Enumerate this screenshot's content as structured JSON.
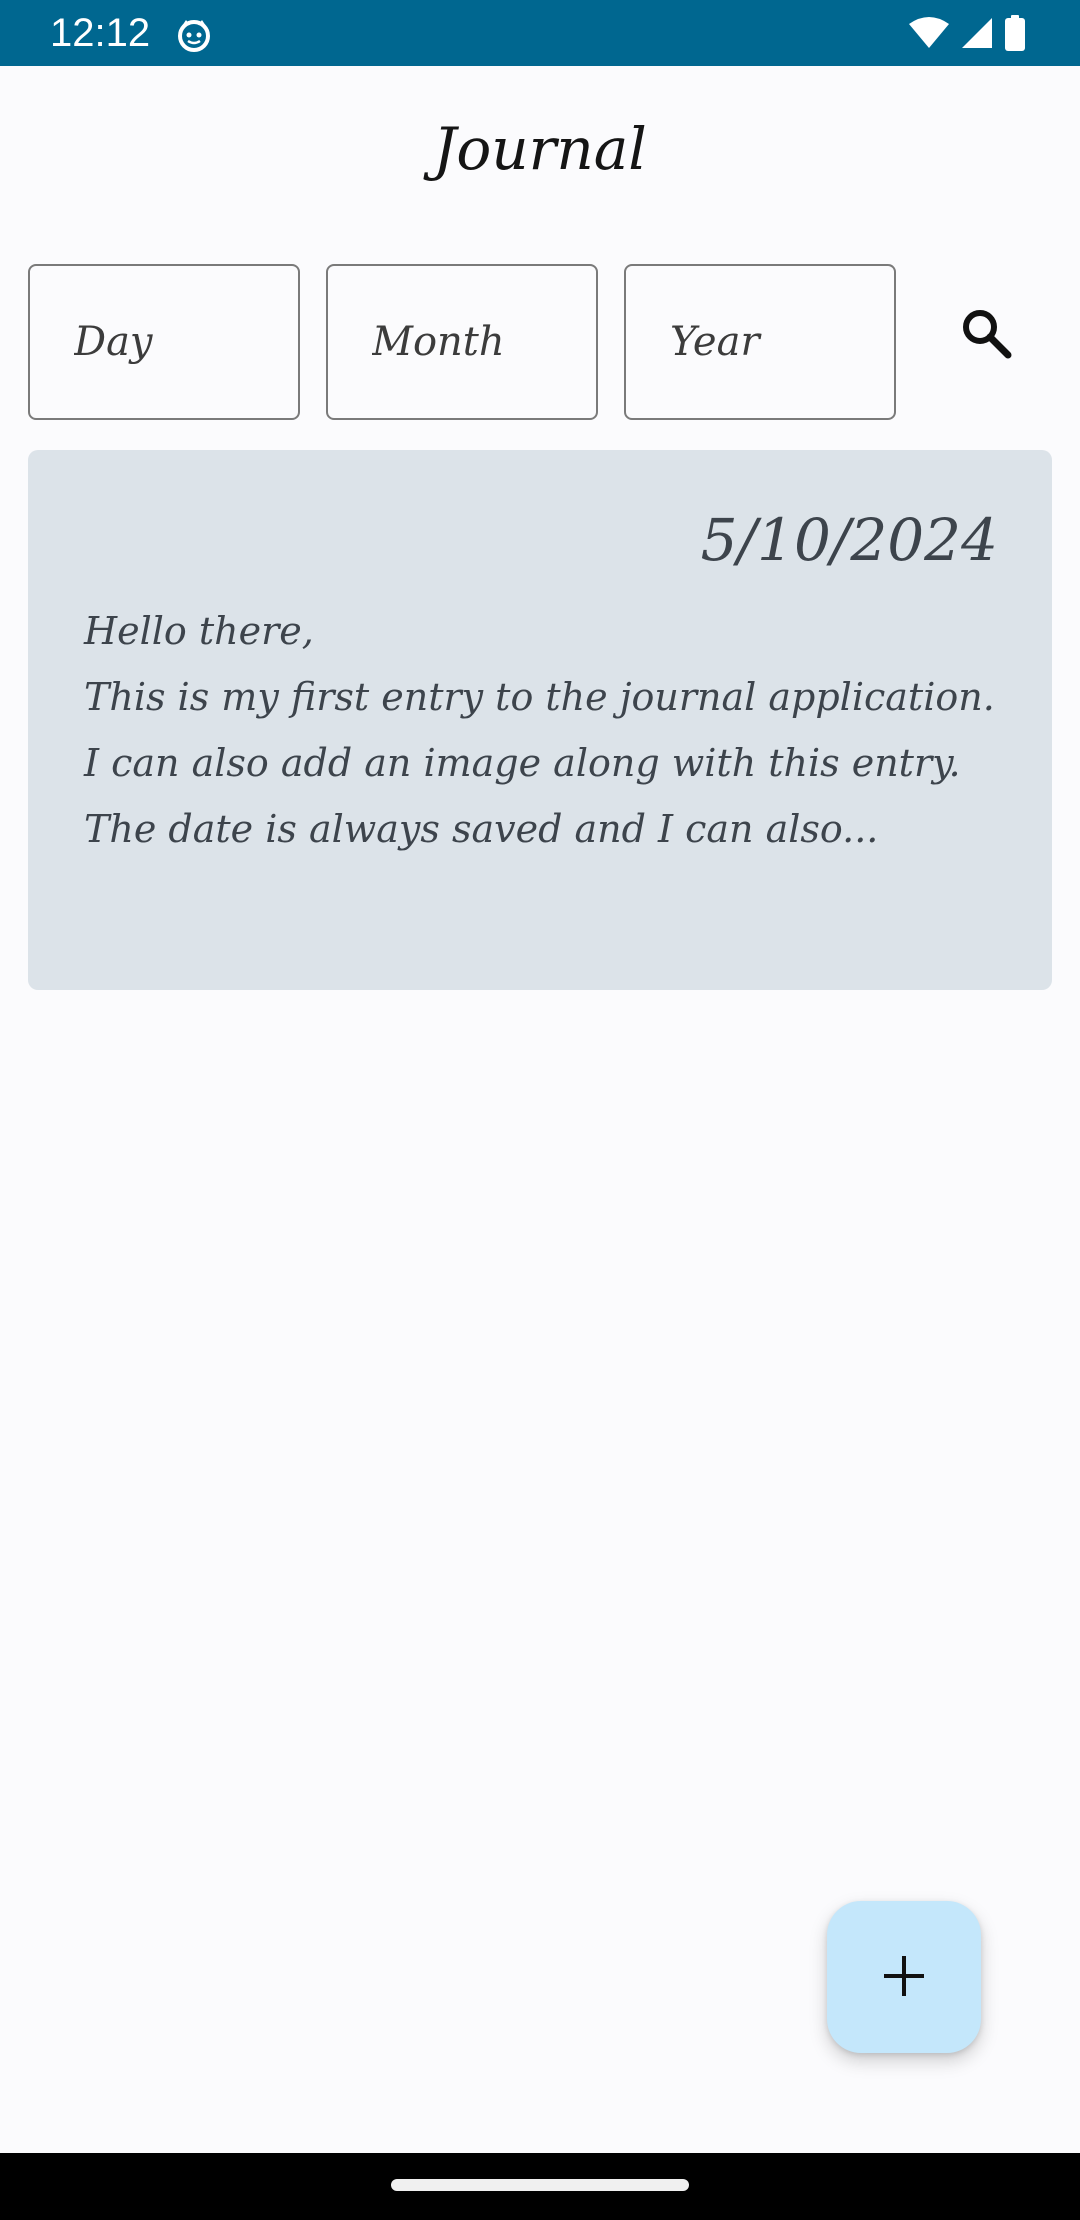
{
  "status_bar": {
    "time": "12:12",
    "app_icon": "cat-face-icon",
    "icons": [
      "wifi-icon",
      "signal-icon",
      "battery-icon"
    ]
  },
  "header": {
    "title": "Journal"
  },
  "filters": {
    "day_placeholder": "Day",
    "month_placeholder": "Month",
    "year_placeholder": "Year",
    "search_icon": "search-icon"
  },
  "entries": [
    {
      "date": "5/10/2024",
      "preview": "Hello there,\nThis is my first entry to the journal application. I can also add an image along with this entry. The date is always saved and I can also..."
    }
  ],
  "fab": {
    "icon": "plus-icon"
  },
  "colors": {
    "status_bar": "#006790",
    "background": "#fbfbfd",
    "card": "#dce3e9",
    "fab": "#c4e7fb",
    "text_dark": "#151515",
    "text_muted": "#3d444c"
  }
}
